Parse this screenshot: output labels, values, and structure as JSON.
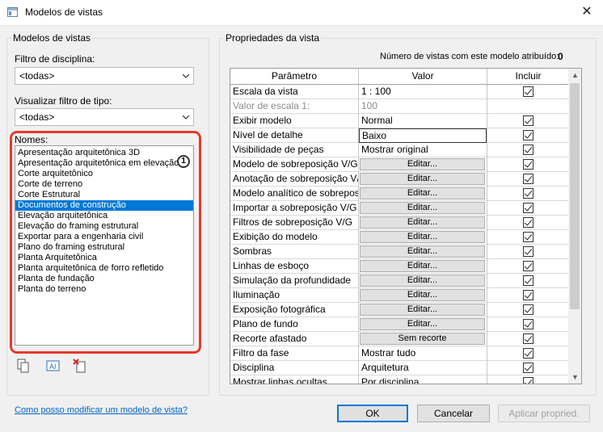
{
  "window": {
    "title": "Modelos de vistas",
    "close_glyph": "✕"
  },
  "left_panel": {
    "title": "Modelos de vistas",
    "discipline_filter": {
      "label": "Filtro de disciplina:",
      "value": "<todas>"
    },
    "type_filter": {
      "label": "Visualizar filtro de tipo:",
      "value": "<todas>"
    },
    "names": {
      "label": "Nomes:",
      "items": [
        "Apresentação arquitetônica 3D",
        "Apresentação arquitetônica em elevação",
        "Corte arquitetônico",
        "Corte de terreno",
        "Corte Estrutural",
        "Documentos de construção",
        "Elevação arquitetônica",
        "Elevação do framing estrutural",
        "Exportar para a engenharia civil",
        "Plano do framing estrutural",
        "Planta Arquitetônica",
        "Planta arquitetônica de forro refletido",
        "Planta de fundação",
        "Planta do terreno"
      ],
      "selected": "Documentos de construção"
    },
    "callout_number": "1",
    "tools": [
      "duplicate-icon",
      "rename-icon",
      "delete-icon"
    ]
  },
  "right_panel": {
    "title": "Propriedades da vista",
    "assigned_label": "Número de vistas com este modelo atribuído:",
    "assigned_count": "0",
    "columns": [
      "Parâmetro",
      "Valor",
      "Incluir"
    ],
    "rows": [
      {
        "param": "Escala da vista",
        "value": "1 : 100",
        "type": "text",
        "include": true
      },
      {
        "param": "Valor de escala    1:",
        "value": "100",
        "type": "grey",
        "include": null
      },
      {
        "param": "Exibir modelo",
        "value": "Normal",
        "type": "text",
        "include": true
      },
      {
        "param": "Nível de detalhe",
        "value": "Baixo",
        "type": "box",
        "include": true
      },
      {
        "param": "Visibilidade de peças",
        "value": "Mostrar original",
        "type": "text",
        "include": true
      },
      {
        "param": "Modelo de sobreposição V/G",
        "value": "Editar...",
        "type": "button",
        "include": true
      },
      {
        "param": "Anotação de sobreposição V/G",
        "value": "Editar...",
        "type": "button",
        "include": true
      },
      {
        "param": "Modelo analítico de sobreposição",
        "value": "Editar...",
        "type": "button",
        "include": true
      },
      {
        "param": "Importar a sobreposição V/G",
        "value": "Editar...",
        "type": "button",
        "include": true
      },
      {
        "param": "Filtros de sobreposição V/G",
        "value": "Editar...",
        "type": "button",
        "include": true
      },
      {
        "param": "Exibição do modelo",
        "value": "Editar...",
        "type": "button",
        "include": true
      },
      {
        "param": "Sombras",
        "value": "Editar...",
        "type": "button",
        "include": true
      },
      {
        "param": "Linhas de esboço",
        "value": "Editar...",
        "type": "button",
        "include": true
      },
      {
        "param": "Simulação da profundidade",
        "value": "Editar...",
        "type": "button",
        "include": true
      },
      {
        "param": "Iluminação",
        "value": "Editar...",
        "type": "button",
        "include": true
      },
      {
        "param": "Exposição fotográfica",
        "value": "Editar...",
        "type": "button",
        "include": true
      },
      {
        "param": "Plano de fundo",
        "value": "Editar...",
        "type": "button",
        "include": true
      },
      {
        "param": "Recorte afastado",
        "value": "Sem recorte",
        "type": "button",
        "include": true
      },
      {
        "param": "Filtro da fase",
        "value": "Mostrar tudo",
        "type": "text",
        "include": true
      },
      {
        "param": "Disciplina",
        "value": "Arquitetura",
        "type": "text",
        "include": true
      },
      {
        "param": "Mostrar linhas ocultas",
        "value": "Por disciplina",
        "type": "text",
        "include": true
      }
    ]
  },
  "footer": {
    "help_link": "Como posso modificar um modelo de vista?",
    "ok": "OK",
    "cancel": "Cancelar",
    "apply": "Aplicar propried."
  },
  "colors": {
    "selection": "#0078d7",
    "highlight_ring": "#e8382e",
    "link": "#0066cc"
  }
}
